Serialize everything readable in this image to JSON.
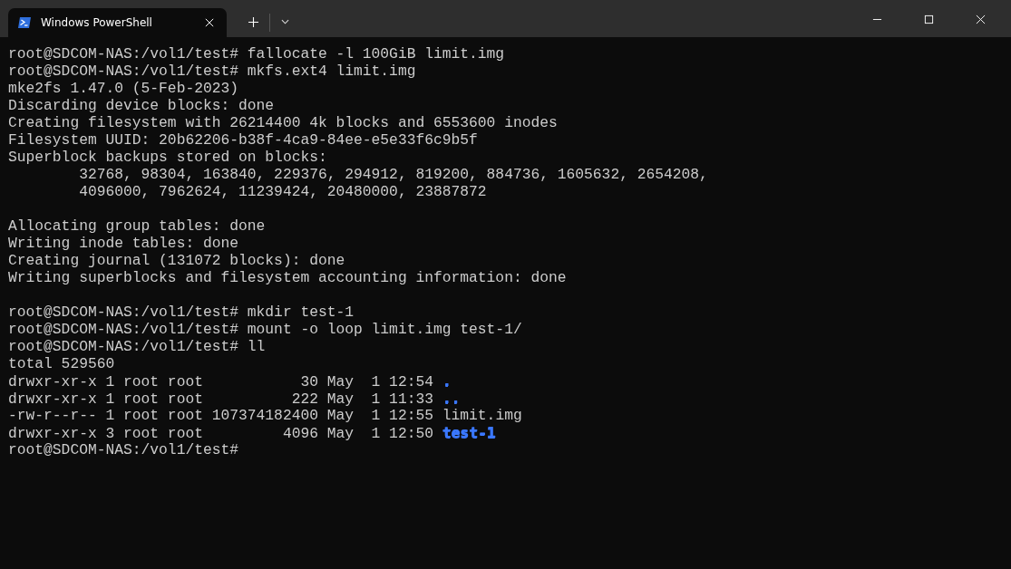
{
  "tabs": [
    {
      "title": "Windows PowerShell",
      "selected": true
    }
  ],
  "terminal": {
    "lines": [
      {
        "kind": "text",
        "text": "root@SDCOM-NAS:/vol1/test# fallocate -l 100GiB limit.img"
      },
      {
        "kind": "text",
        "text": "root@SDCOM-NAS:/vol1/test# mkfs.ext4 limit.img"
      },
      {
        "kind": "text",
        "text": "mke2fs 1.47.0 (5-Feb-2023)"
      },
      {
        "kind": "text",
        "text": "Discarding device blocks: done"
      },
      {
        "kind": "text",
        "text": "Creating filesystem with 26214400 4k blocks and 6553600 inodes"
      },
      {
        "kind": "text",
        "text": "Filesystem UUID: 20b62206-b38f-4ca9-84ee-e5e33f6c9b5f"
      },
      {
        "kind": "text",
        "text": "Superblock backups stored on blocks:"
      },
      {
        "kind": "text",
        "text": "        32768, 98304, 163840, 229376, 294912, 819200, 884736, 1605632, 2654208,"
      },
      {
        "kind": "text",
        "text": "        4096000, 7962624, 11239424, 20480000, 23887872"
      },
      {
        "kind": "blank"
      },
      {
        "kind": "text",
        "text": "Allocating group tables: done"
      },
      {
        "kind": "text",
        "text": "Writing inode tables: done"
      },
      {
        "kind": "text",
        "text": "Creating journal (131072 blocks): done"
      },
      {
        "kind": "text",
        "text": "Writing superblocks and filesystem accounting information: done"
      },
      {
        "kind": "blank"
      },
      {
        "kind": "text",
        "text": "root@SDCOM-NAS:/vol1/test# mkdir test-1"
      },
      {
        "kind": "text",
        "text": "root@SDCOM-NAS:/vol1/test# mount -o loop limit.img test-1/"
      },
      {
        "kind": "text",
        "text": "root@SDCOM-NAS:/vol1/test# ll"
      },
      {
        "kind": "text",
        "text": "total 529560"
      },
      {
        "kind": "listing",
        "text": "drwxr-xr-x 1 root root           30 May  1 12:54",
        "name": ".",
        "color": "#3b78ff",
        "bold": true
      },
      {
        "kind": "listing",
        "text": "drwxr-xr-x 1 root root          222 May  1 11:33",
        "name": "..",
        "color": "#3b78ff",
        "bold": true
      },
      {
        "kind": "listing",
        "text": "-rw-r--r-- 1 root root 107374182400 May  1 12:55",
        "name": "limit.img",
        "color": "#cccccc",
        "bold": false
      },
      {
        "kind": "listing",
        "text": "drwxr-xr-x 3 root root         4096 May  1 12:50",
        "name": "test-1",
        "color": "#3b78ff",
        "bold": true
      },
      {
        "kind": "text",
        "text": "root@SDCOM-NAS:/vol1/test#"
      }
    ]
  }
}
